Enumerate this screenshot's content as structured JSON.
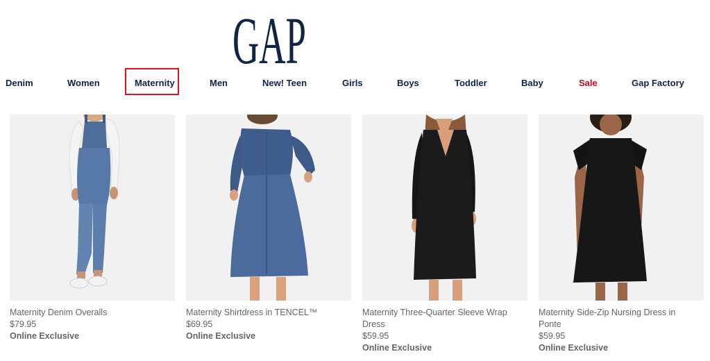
{
  "brand": {
    "logo_text": "GAP",
    "logo_color": "#122344"
  },
  "nav": {
    "items": [
      {
        "label": "Denim"
      },
      {
        "label": "Women"
      },
      {
        "label": "Maternity",
        "highlighted": true
      },
      {
        "label": "Men"
      },
      {
        "label": "New! Teen"
      },
      {
        "label": "Girls"
      },
      {
        "label": "Boys"
      },
      {
        "label": "Toddler"
      },
      {
        "label": "Baby"
      },
      {
        "label": "Sale",
        "color": "#c00d1e"
      },
      {
        "label": "Gap Factory"
      }
    ],
    "highlight_color": "#e3121e"
  },
  "products": [
    {
      "name": "Maternity Denim Overalls",
      "price": "$79.95",
      "badge": "Online Exclusive",
      "image": "woman-in-denim-overalls"
    },
    {
      "name": "Maternity Shirtdress in TENCEL™",
      "price": "$69.95",
      "badge": "Online Exclusive",
      "image": "woman-in-denim-shirtdress"
    },
    {
      "name": "Maternity Three-Quarter Sleeve Wrap Dress",
      "price": "$59.95",
      "badge": "Online Exclusive",
      "image": "woman-in-black-wrap-dress"
    },
    {
      "name": "Maternity Side-Zip Nursing Dress in Ponte",
      "price": "$59.95",
      "badge": "Online Exclusive",
      "image": "woman-in-black-tshirt-dress"
    }
  ]
}
